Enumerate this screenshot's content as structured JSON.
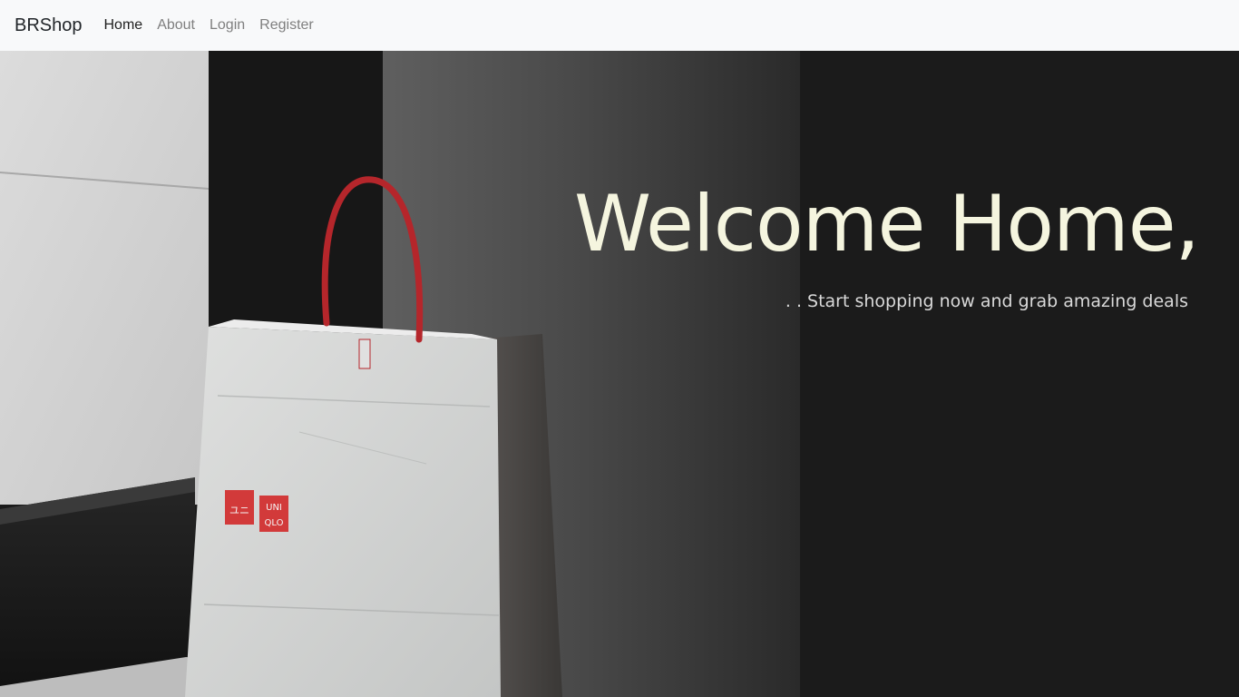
{
  "navbar": {
    "brand": "BRShop",
    "links": [
      {
        "label": "Home",
        "active": true
      },
      {
        "label": "About",
        "active": false
      },
      {
        "label": "Login",
        "active": false
      },
      {
        "label": "Register",
        "active": false
      }
    ]
  },
  "hero": {
    "title": "Welcome Home,",
    "subtitle": ". . Start shopping now and grab amazing deals",
    "image": {
      "bag_brand_text_line1": "UNI",
      "bag_brand_text_line2": "QLO"
    }
  },
  "colors": {
    "navbar_bg": "#f8f9fa",
    "hero_bg": "#1b1b1b",
    "title": "#f5f5df",
    "bag_logo": "#d23a3a"
  }
}
